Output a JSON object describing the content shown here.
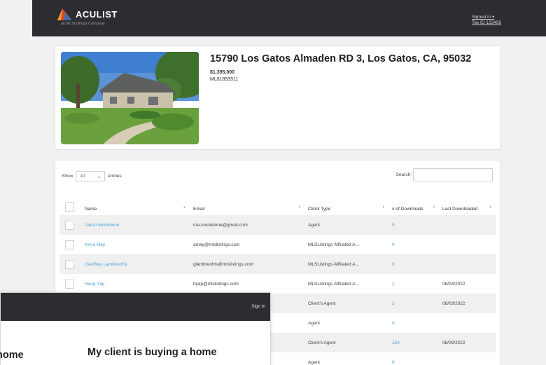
{
  "header": {
    "brand": "ACULIST",
    "brand_sub": "an MLSListings Company",
    "signed_in": "Signed in",
    "tax_id": "Tax ID 123456"
  },
  "listing": {
    "address": "15790 Los Gatos Almaden RD 3, Los Gatos, CA, 95032",
    "price": "$1,395,000",
    "mls": "ML81893511"
  },
  "table_controls": {
    "show_label": "Show",
    "entries_value": "10",
    "entries_label": "entries",
    "search_label": "Search:"
  },
  "columns": {
    "name": "Name",
    "email": "Email",
    "client_type": "Client Type",
    "downloads": "# of Downloads",
    "last_downloaded": "Last Downloaded"
  },
  "rows": [
    {
      "name": "Aaron Montelone",
      "email": "roa.montelone@gmail.com",
      "client_type": "Agent",
      "downloads": "0",
      "last": ""
    },
    {
      "name": "Anna May",
      "email": "amay@mlslistings.com",
      "client_type": "MLSListings Affiliated A...",
      "downloads": "0",
      "last": ""
    },
    {
      "name": "Geoffrey Lambrechts",
      "email": "glambrechts@mlslistings.com",
      "client_type": "MLSListings Affiliated A...",
      "downloads": "0",
      "last": ""
    },
    {
      "name": "Hang Yap",
      "email": "hyap@mlslistings.com",
      "client_type": "MLSListings Affiliated A...",
      "downloads": "1",
      "last": "08/04/2022"
    },
    {
      "name": "",
      "email": "",
      "client_type": "Client's Agent",
      "downloads": "3",
      "last": "08/03/2022"
    },
    {
      "name": "",
      "email": "",
      "client_type": "Agent",
      "downloads": "0",
      "last": ""
    },
    {
      "name": "",
      "email": "",
      "client_type": "Client's Agent",
      "downloads": "150",
      "last": "08/09/2022"
    },
    {
      "name": "",
      "email": "",
      "client_type": "Agent",
      "downloads": "0",
      "last": ""
    }
  ],
  "overlay": {
    "sign_in": "Sign in",
    "left_heading": "home",
    "right_heading": "My client is buying a home"
  },
  "colors": {
    "header_bg": "#2b2d31",
    "link": "#4aa3df",
    "logo_orange": "#f0a22e",
    "logo_red": "#d84a2f",
    "logo_blue": "#3c6fb6"
  }
}
